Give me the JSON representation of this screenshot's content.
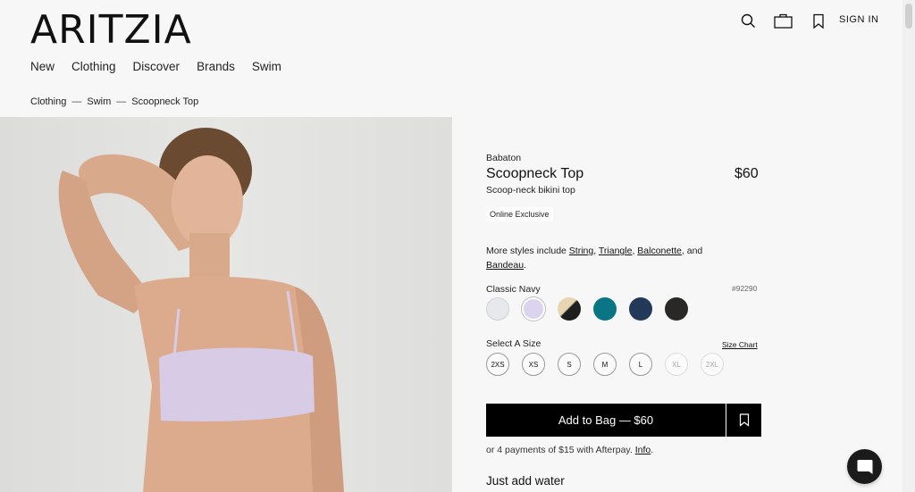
{
  "header": {
    "logo": "ARITZIA",
    "sign_in": "SIGN IN",
    "icons": [
      "search-icon",
      "bag-icon",
      "bookmark-icon"
    ]
  },
  "nav": {
    "items": [
      {
        "label": "New"
      },
      {
        "label": "Clothing"
      },
      {
        "label": "Discover"
      },
      {
        "label": "Brands"
      },
      {
        "label": "Swim"
      }
    ]
  },
  "breadcrumb": {
    "items": [
      "Clothing",
      "Swim",
      "Scoopneck Top"
    ],
    "separator": "—"
  },
  "product": {
    "brand": "Babaton",
    "title": "Scoopneck Top",
    "price": "$60",
    "subtitle": "Scoop-neck bikini top",
    "badge": "Online Exclusive",
    "styles_prefix": "More styles include",
    "styles_links": [
      "String",
      "Triangle",
      "Balconette",
      "Bandeau"
    ],
    "styles_sep1": ", ",
    "styles_sep2": ", ",
    "styles_and": ", and ",
    "styles_end": ".",
    "color_name": "Classic Navy",
    "sku": "#92290",
    "swatches": [
      {
        "name": "light-grey",
        "color": "#e6e8ec"
      },
      {
        "name": "lilac",
        "color": "#dcd3ee"
      },
      {
        "name": "black-gold",
        "color": "#2a2a2a"
      },
      {
        "name": "teal",
        "color": "#0a7585"
      },
      {
        "name": "navy",
        "color": "#22395a"
      },
      {
        "name": "black",
        "color": "#2a2727"
      }
    ],
    "size_label": "Select A Size",
    "size_chart": "Size Chart",
    "sizes": [
      {
        "label": "2XS",
        "available": true
      },
      {
        "label": "XS",
        "available": true
      },
      {
        "label": "S",
        "available": true
      },
      {
        "label": "M",
        "available": true
      },
      {
        "label": "L",
        "available": true
      },
      {
        "label": "XL",
        "available": false
      },
      {
        "label": "2XL",
        "available": false
      }
    ],
    "add_to_bag": "Add to Bag — $60",
    "afterpay_text": "or 4 payments of $15 with Afterpay.",
    "afterpay_link": "Info",
    "afterpay_end": ".",
    "section_title": "Just add water"
  },
  "colors": {
    "accent": "#000000",
    "background": "#f7f7f7"
  }
}
